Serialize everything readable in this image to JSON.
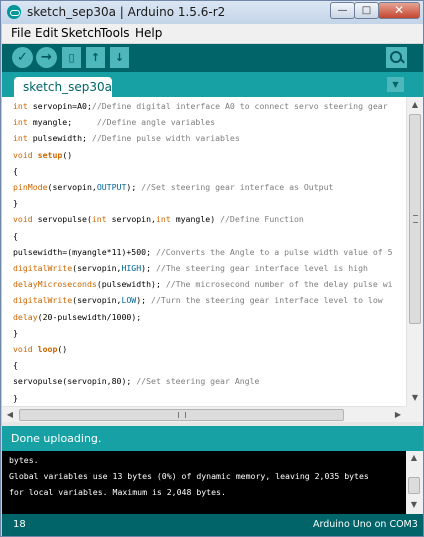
{
  "window": {
    "title": "sketch_sep30a | Arduino 1.5.6-r2",
    "minimize_glyph": "—",
    "maximize_glyph": "□",
    "close_glyph": "✕"
  },
  "menu": [
    "File",
    "Edit",
    "Sketch",
    "Tools",
    "Help"
  ],
  "toolbar": {
    "verify_glyph": "✓",
    "upload_glyph": "→",
    "new_glyph": "▯",
    "open_glyph": "↑",
    "save_glyph": "↓",
    "serial_monitor_icon": "magnifier-icon"
  },
  "tabs": {
    "active_label": "sketch_sep30a §",
    "menu_glyph": "▼"
  },
  "code": [
    [
      {
        "t": "int",
        "c": "kw-type"
      },
      {
        "t": " servopin=A0;"
      },
      {
        "t": "//Define digital interface A0 to connect servo steering gear",
        "c": "cmt"
      }
    ],
    [
      {
        "t": "int",
        "c": "kw-type"
      },
      {
        "t": " myangle;     "
      },
      {
        "t": "//Define angle variables",
        "c": "cmt"
      }
    ],
    [
      {
        "t": "int",
        "c": "kw-type"
      },
      {
        "t": " pulsewidth; "
      },
      {
        "t": "//Define pulse width variables",
        "c": "cmt"
      }
    ],
    [
      {
        "t": "void",
        "c": "kw-type"
      },
      {
        "t": " "
      },
      {
        "t": "setup",
        "c": "kw-bold"
      },
      {
        "t": "()"
      }
    ],
    [
      {
        "t": "{"
      }
    ],
    [
      {
        "t": "pinMode",
        "c": "kw-fn"
      },
      {
        "t": "(servopin,"
      },
      {
        "t": "OUTPUT",
        "c": "kw-const"
      },
      {
        "t": "); "
      },
      {
        "t": "//Set steering gear interface as Output",
        "c": "cmt"
      }
    ],
    [
      {
        "t": "}"
      }
    ],
    [
      {
        "t": "void",
        "c": "kw-type"
      },
      {
        "t": " servopulse("
      },
      {
        "t": "int",
        "c": "kw-type"
      },
      {
        "t": " servopin,"
      },
      {
        "t": "int",
        "c": "kw-type"
      },
      {
        "t": " myangle) "
      },
      {
        "t": "//Define Function",
        "c": "cmt"
      }
    ],
    [
      {
        "t": "{"
      }
    ],
    [
      {
        "t": "pulsewidth=(myangle*11)+500; "
      },
      {
        "t": "//Converts the Angle to a pulse width value of 5",
        "c": "cmt"
      }
    ],
    [
      {
        "t": "digitalWrite",
        "c": "kw-fn"
      },
      {
        "t": "(servopin,"
      },
      {
        "t": "HIGH",
        "c": "kw-const"
      },
      {
        "t": "); "
      },
      {
        "t": "//The steering gear interface level is high",
        "c": "cmt"
      }
    ],
    [
      {
        "t": "delayMicroseconds",
        "c": "kw-fn"
      },
      {
        "t": "(pulsewidth); "
      },
      {
        "t": "//The microsecond number of the delay pulse wi",
        "c": "cmt"
      }
    ],
    [
      {
        "t": "digitalWrite",
        "c": "kw-fn"
      },
      {
        "t": "(servopin,"
      },
      {
        "t": "LOW",
        "c": "kw-const"
      },
      {
        "t": "); "
      },
      {
        "t": "//Turn the steering gear interface level to low",
        "c": "cmt"
      }
    ],
    [
      {
        "t": "delay",
        "c": "kw-fn"
      },
      {
        "t": "(20-pulsewidth/1000);"
      }
    ],
    [
      {
        "t": "}"
      }
    ],
    [
      {
        "t": "void",
        "c": "kw-type"
      },
      {
        "t": " "
      },
      {
        "t": "loop",
        "c": "kw-bold"
      },
      {
        "t": "()"
      }
    ],
    [
      {
        "t": "{"
      }
    ],
    [
      {
        "t": "servopulse(servopin,80); "
      },
      {
        "t": "//Set steering gear Angle",
        "c": "cmt"
      }
    ],
    [
      {
        "t": "}"
      }
    ]
  ],
  "scrollbars": {
    "up_glyph": "▲",
    "down_glyph": "▼",
    "left_glyph": "◀",
    "right_glyph": "▶"
  },
  "status": {
    "message": "Done uploading."
  },
  "console": [
    "bytes.",
    "Global variables use 13 bytes (0%) of dynamic memory, leaving 2,035 bytes",
    "for local variables. Maximum is 2,048 bytes."
  ],
  "footer": {
    "line_number": "18",
    "board_info": "Arduino Uno on COM3"
  },
  "colors": {
    "toolbar": "#006468",
    "tabbar": "#17a1a5",
    "button": "#4db7bb",
    "keyword": "#cc6600",
    "constant": "#006699",
    "comment": "#7e7e7e"
  }
}
